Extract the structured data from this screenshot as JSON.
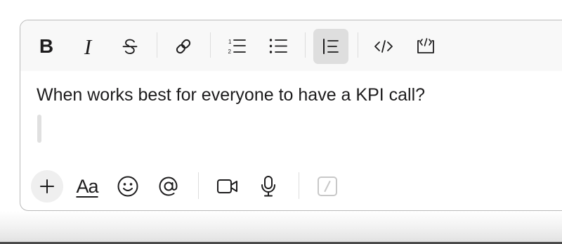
{
  "composer": {
    "message_text": "When works best for everyone to have a KPI call?"
  },
  "toolbar": {
    "items": [
      {
        "name": "bold",
        "glyph": "B",
        "icon": "bold-icon",
        "active": false
      },
      {
        "name": "italic",
        "glyph": "I",
        "icon": "italic-icon",
        "active": false
      },
      {
        "name": "strikethrough",
        "icon": "strikethrough-icon",
        "active": false
      },
      {
        "name": "link",
        "icon": "link-icon",
        "active": false
      },
      {
        "name": "ordered-list",
        "icon": "ordered-list-icon",
        "active": false
      },
      {
        "name": "bulleted-list",
        "icon": "bulleted-list-icon",
        "active": false
      },
      {
        "name": "blockquote",
        "icon": "blockquote-icon",
        "active": true
      },
      {
        "name": "code",
        "icon": "code-icon",
        "active": false
      },
      {
        "name": "code-block",
        "icon": "code-block-icon",
        "active": false
      }
    ]
  },
  "actions": {
    "format_toggle_label": "Aa",
    "items": [
      {
        "name": "attach",
        "icon": "plus-icon"
      },
      {
        "name": "format-toggle",
        "icon": "text-format-icon"
      },
      {
        "name": "emoji",
        "icon": "emoji-icon"
      },
      {
        "name": "mention",
        "icon": "at-mention-icon"
      },
      {
        "name": "video-clip",
        "icon": "video-camera-icon"
      },
      {
        "name": "audio-clip",
        "icon": "microphone-icon"
      },
      {
        "name": "shortcuts",
        "icon": "slash-command-icon"
      }
    ]
  },
  "colors": {
    "text": "#1d1c1d",
    "toolbar_background": "#f8f8f8",
    "active_button_background": "#dedede",
    "border": "#b9b9b9",
    "disabled_icon": "#c8c8c8"
  }
}
